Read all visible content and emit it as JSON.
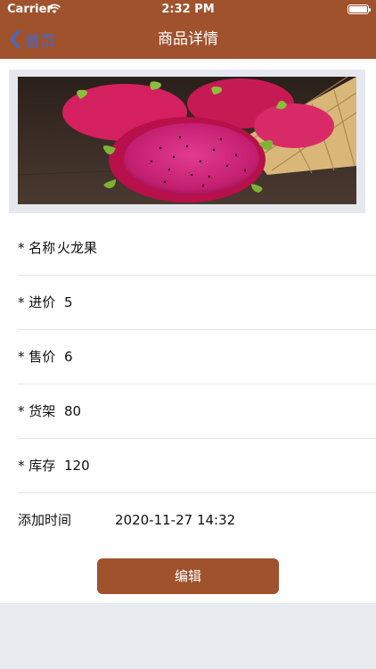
{
  "status_bar": {
    "carrier": "Carrier",
    "time": "2:32 PM"
  },
  "nav": {
    "back_label": "首页",
    "title": "商品详情"
  },
  "product": {
    "image_icon": "dragon-fruit-photo",
    "fields": [
      {
        "label": "* 名称",
        "value": "火龙果"
      },
      {
        "label": "* 进价",
        "value": "5"
      },
      {
        "label": "* 售价",
        "value": "6"
      },
      {
        "label": "* 货架",
        "value": "80"
      },
      {
        "label": "* 库存",
        "value": "120"
      },
      {
        "label": "添加时间",
        "value": "2020-11-27 14:32"
      }
    ]
  },
  "actions": {
    "edit_label": "编辑"
  },
  "colors": {
    "brand": "#a0522d",
    "back_link": "#3a6ad6"
  }
}
